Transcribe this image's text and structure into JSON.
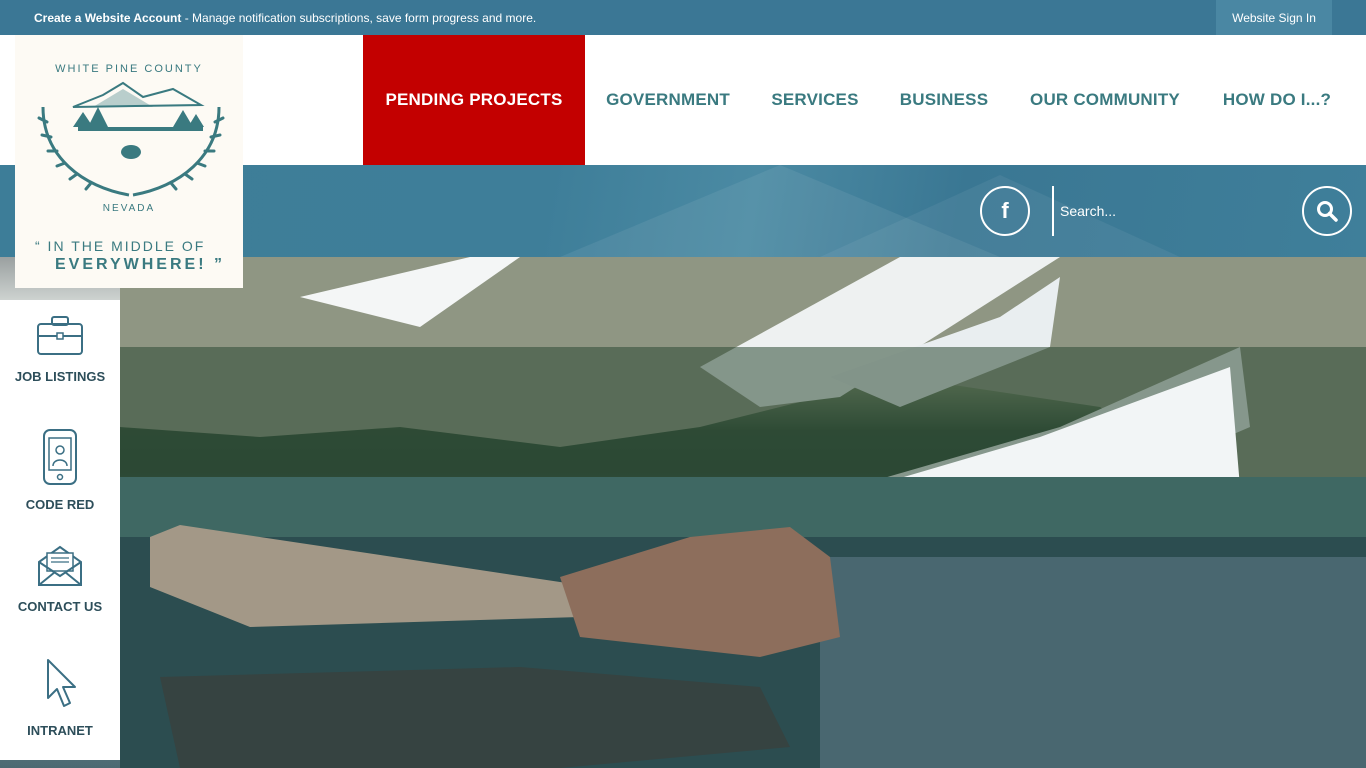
{
  "topbar": {
    "account_bold": "Create a Website Account",
    "account_rest": " - Manage notification subscriptions, save form progress and more.",
    "signin_label": "Website Sign In"
  },
  "logo": {
    "county": "WHITE PINE COUNTY",
    "state": "NEVADA",
    "tagline_line1": "“ IN THE MIDDLE OF",
    "tagline_line2": "EVERYWHERE! ”"
  },
  "nav": {
    "items": [
      {
        "label": "PENDING PROJECTS"
      },
      {
        "label": "GOVERNMENT"
      },
      {
        "label": "SERVICES"
      },
      {
        "label": "BUSINESS"
      },
      {
        "label": "OUR COMMUNITY"
      },
      {
        "label": "HOW DO I...?"
      }
    ]
  },
  "banner": {
    "facebook_glyph": "f",
    "search_placeholder": "Search..."
  },
  "quick_links": [
    {
      "label": "JOB LISTINGS",
      "icon": "briefcase-icon"
    },
    {
      "label": "CODE RED",
      "icon": "mobile-phone-icon"
    },
    {
      "label": "CONTACT US",
      "icon": "envelope-icon"
    },
    {
      "label": "INTRANET",
      "icon": "cursor-icon"
    }
  ],
  "colors": {
    "topbar": "#3b7795",
    "accent_red": "#c30000",
    "nav_text": "#3a7a80",
    "banner": "#3d7d98"
  }
}
